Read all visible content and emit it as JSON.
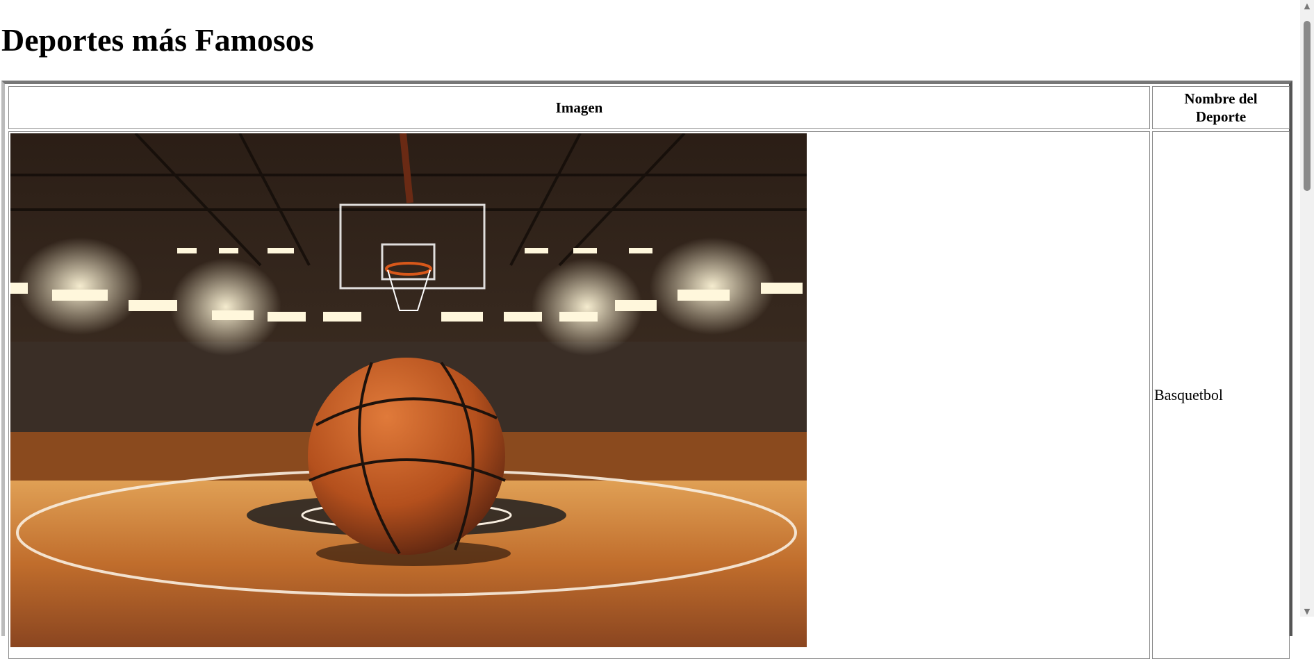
{
  "page": {
    "title": "Deportes más Famosos"
  },
  "table": {
    "headers": {
      "image": "Imagen",
      "name": "Nombre del Deporte"
    },
    "rows": [
      {
        "image_icon": "basketball-court-photo",
        "name": "Basquetbol"
      }
    ]
  },
  "scrollbar": {
    "up_icon": "scroll-up-arrow-icon",
    "down_icon": "scroll-down-arrow-icon"
  },
  "colors": {
    "court_wood": "#c86a2a",
    "ball": "#c0531e",
    "arena_dark": "#1a1512"
  }
}
